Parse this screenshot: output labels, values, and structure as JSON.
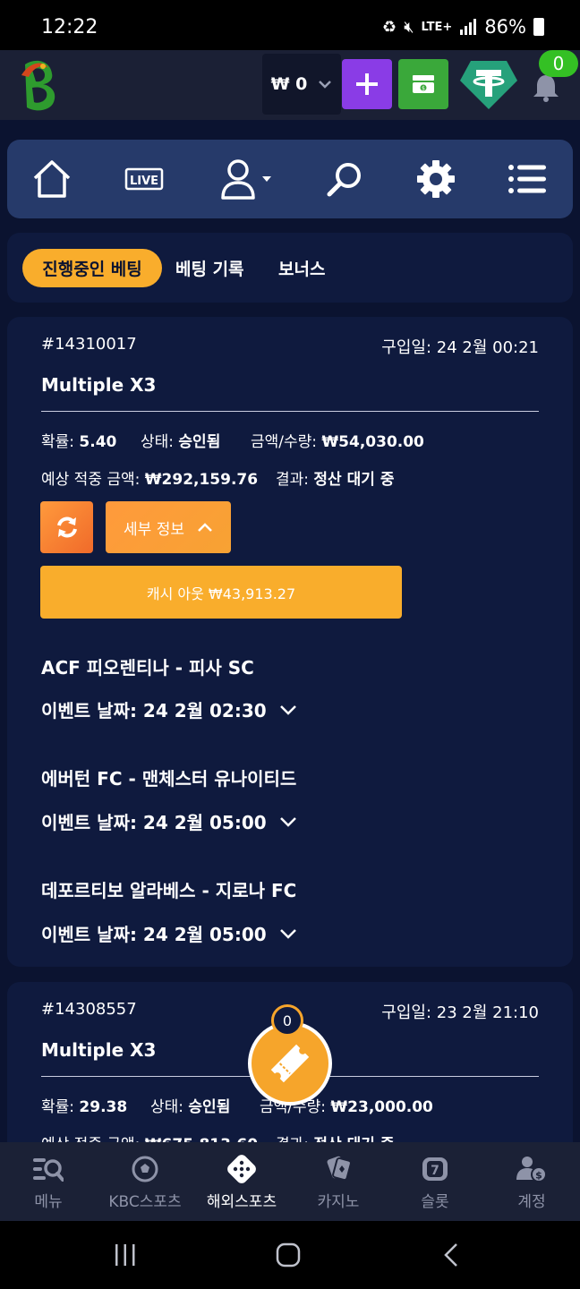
{
  "status_bar": {
    "time": "12:22",
    "network": "LTE+",
    "battery": "86%"
  },
  "header": {
    "balance": "₩ 0",
    "notification_count": "0"
  },
  "tabs": [
    {
      "label": "진행중인 베팅",
      "active": true
    },
    {
      "label": "베팅 기록",
      "active": false
    },
    {
      "label": "보너스",
      "active": false
    }
  ],
  "bets": [
    {
      "id": "#14310017",
      "purchase_date": "구입일: 24 2월 00:21",
      "title": "Multiple X3",
      "odds_label": "확률:",
      "odds": "5.40",
      "status_label": "상태:",
      "status": "승인됨",
      "amount_label": "금액/수량:",
      "amount": "₩54,030.00",
      "expected_label": "예상 적중 금액:",
      "expected": "₩292,159.76",
      "result_label": "결과:",
      "result": "정산 대기 중",
      "detail_label": "세부 정보",
      "cashout_label": "캐시 아웃 ₩43,913.27",
      "events": [
        {
          "name": "ACF 피오렌티나 - 피사 SC",
          "date": "이벤트 날짜: 24 2월 02:30"
        },
        {
          "name": "에버턴 FC - 맨체스터 유나이티드",
          "date": "이벤트 날짜: 24 2월 05:00"
        },
        {
          "name": "데포르티보 알라베스 - 지로나 FC",
          "date": "이벤트 날짜: 24 2월 05:00"
        }
      ]
    },
    {
      "id": "#14308557",
      "purchase_date": "구입일: 23 2월 21:10",
      "title": "Multiple X3",
      "odds_label": "확률:",
      "odds": "29.38",
      "status_label": "상태:",
      "status": "승인됨",
      "amount_label": "금액/수량:",
      "amount": "₩23,000.00",
      "expected_label": "예상 적중 금액:",
      "expected": "₩675,813.60",
      "result_label": "결과:",
      "result": "정산 대기 중"
    }
  ],
  "betslip_count": "0",
  "bottom_nav": [
    {
      "label": "메뉴",
      "icon": "menu-search-icon",
      "active": false
    },
    {
      "label": "KBC스포츠",
      "icon": "soccer-ball-icon",
      "active": false
    },
    {
      "label": "해외스포츠",
      "icon": "dice-icon",
      "active": true
    },
    {
      "label": "카지노",
      "icon": "cards-icon",
      "active": false
    },
    {
      "label": "슬롯",
      "icon": "slot-seven-icon",
      "active": false
    },
    {
      "label": "계정",
      "icon": "account-money-icon",
      "active": false
    }
  ],
  "colors": {
    "accent": "#f9ad2c",
    "background": "#0b1330",
    "card": "#0f1a3e",
    "nav_card": "#263a6a"
  }
}
